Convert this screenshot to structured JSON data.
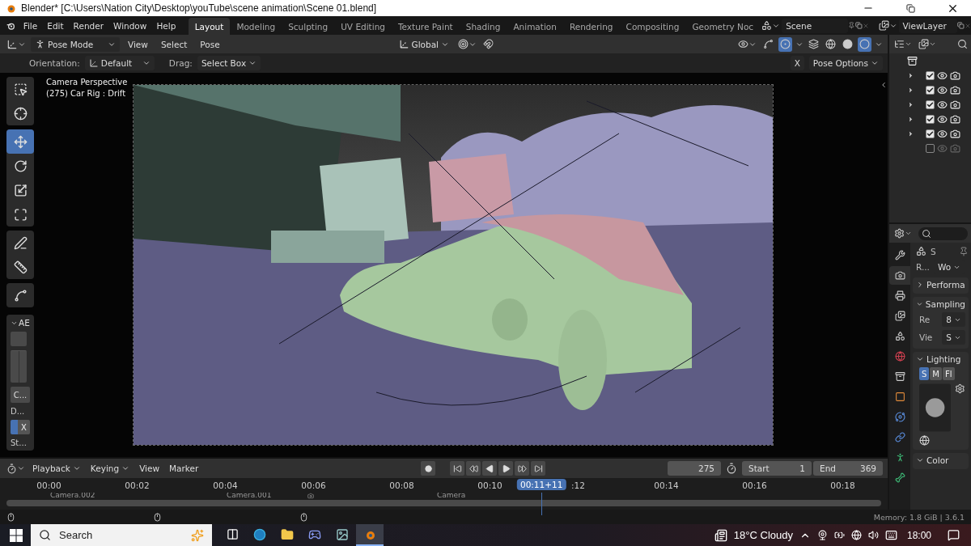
{
  "window": {
    "title": "Blender* [C:\\Users\\Nation City\\Desktop\\youTube\\scene animation\\Scene 01.blend]"
  },
  "menus": [
    "File",
    "Edit",
    "Render",
    "Window",
    "Help"
  ],
  "workspaces": [
    {
      "label": "Layout",
      "selected": true
    },
    {
      "label": "Modeling",
      "selected": false
    },
    {
      "label": "Sculpting",
      "selected": false
    },
    {
      "label": "UV Editing",
      "selected": false
    },
    {
      "label": "Texture Paint",
      "selected": false
    },
    {
      "label": "Shading",
      "selected": false
    },
    {
      "label": "Animation",
      "selected": false
    },
    {
      "label": "Rendering",
      "selected": false
    },
    {
      "label": "Compositing",
      "selected": false
    },
    {
      "label": "Geometry Noc",
      "selected": false
    }
  ],
  "scene": "Scene",
  "view_layer": "ViewLayer",
  "header": {
    "mode": "Pose Mode",
    "menus": [
      "View",
      "Select",
      "Pose"
    ],
    "transform_orientation": "Global"
  },
  "tool_settings": {
    "orientation_label": "Orientation:",
    "orientation": "Default",
    "drag_label": "Drag:",
    "drag": "Select Box",
    "mirror": "X",
    "options": "Pose Options"
  },
  "toolbar": {
    "groups": [
      [
        {
          "kind": "select",
          "selected": false
        },
        {
          "kind": "cursor",
          "selected": false
        }
      ],
      [
        {
          "kind": "move",
          "selected": true
        },
        {
          "kind": "rotate",
          "selected": false
        },
        {
          "kind": "scale",
          "selected": false
        },
        {
          "kind": "transform",
          "selected": false
        }
      ],
      [
        {
          "kind": "annotate",
          "selected": false
        },
        {
          "kind": "measure",
          "selected": false
        }
      ],
      [
        {
          "kind": "bone",
          "selected": false
        }
      ]
    ]
  },
  "tool_panel": {
    "title": "AE",
    "expanded": true,
    "rows": [
      {
        "kind": "swatch"
      },
      {
        "kind": "split"
      },
      {
        "kind": "button",
        "label": "C..."
      },
      {
        "kind": "label",
        "label": "D..."
      },
      {
        "kind": "toggle",
        "label": "X",
        "on": true
      },
      {
        "kind": "label",
        "label": "St..."
      }
    ]
  },
  "viewport": {
    "info": [
      "Camera Perspective",
      "(275) Car Rig : Drift"
    ]
  },
  "outliner": {
    "rows": [
      {
        "expandable": true,
        "checked": true,
        "visible": true,
        "renderable": true
      },
      {
        "expandable": true,
        "checked": true,
        "visible": true,
        "renderable": true
      },
      {
        "expandable": true,
        "checked": true,
        "visible": true,
        "renderable": true
      },
      {
        "expandable": true,
        "checked": true,
        "visible": true,
        "renderable": true
      },
      {
        "expandable": true,
        "checked": true,
        "visible": true,
        "renderable": true
      },
      {
        "expandable": false,
        "checked": false,
        "visible": false,
        "renderable": false
      }
    ]
  },
  "properties": {
    "tabs": [
      {
        "kind": "tool",
        "selected": false
      },
      {
        "kind": "render",
        "selected": true
      },
      {
        "kind": "output",
        "selected": false
      },
      {
        "kind": "view_layer",
        "selected": false
      },
      {
        "kind": "scene",
        "selected": false
      },
      {
        "kind": "world",
        "selected": false
      },
      {
        "kind": "collection",
        "selected": false
      },
      {
        "kind": "object",
        "selected": false
      },
      {
        "kind": "physics",
        "selected": false
      },
      {
        "kind": "constraints",
        "selected": false
      },
      {
        "kind": "armature",
        "selected": false
      },
      {
        "kind": "bone",
        "selected": false
      }
    ],
    "context": "S",
    "engine_label": "R...",
    "engine": "Wo",
    "panels": [
      {
        "title": "Performa",
        "expanded": false
      },
      {
        "title": "Sampling",
        "expanded": true,
        "fields": [
          {
            "label": "Re",
            "value": "8"
          },
          {
            "label": "Vie",
            "value": "S"
          }
        ]
      },
      {
        "title": "Lighting",
        "expanded": true,
        "modes": [
          {
            "label": "S",
            "selected": true
          },
          {
            "label": "M",
            "selected": false
          },
          {
            "label": "Fl",
            "selected": false
          }
        ]
      },
      {
        "title": "Color",
        "expanded": true
      }
    ]
  },
  "timeline": {
    "menus": [
      {
        "label": "Playback",
        "dropdown": true
      },
      {
        "label": "Keying",
        "dropdown": true
      },
      {
        "label": "View",
        "dropdown": false
      },
      {
        "label": "Marker",
        "dropdown": false
      }
    ],
    "frame": "275",
    "start_label": "Start",
    "start": "1",
    "end_label": "End",
    "end": "369",
    "ticks": [
      "00:00",
      "00:02",
      "00:04",
      "00:06",
      "00:08",
      "00:10",
      ":12",
      "00:14",
      "00:16",
      "00:18"
    ],
    "playhead": {
      "label": "00:11+11",
      "level": 0.61
    },
    "markers": [
      {
        "kind": "named",
        "label": "Camera.002"
      },
      {
        "kind": "named",
        "label": "Camera.001"
      },
      {
        "kind": "unnamed"
      },
      {
        "kind": "named",
        "label": "Camera"
      }
    ]
  },
  "status_bar": {
    "memory": "Memory: 1.8 GiB | 3.6.1"
  },
  "taskbar": {
    "search": "Search",
    "apps": [
      {
        "kind": "taskview",
        "selected": false
      },
      {
        "kind": "edge",
        "selected": false
      },
      {
        "kind": "folder",
        "selected": false
      },
      {
        "kind": "chat",
        "selected": false
      },
      {
        "kind": "viewer",
        "selected": false
      },
      {
        "kind": "blender",
        "selected": true
      }
    ],
    "weather": "18°C Cloudy",
    "time": "18:00"
  }
}
